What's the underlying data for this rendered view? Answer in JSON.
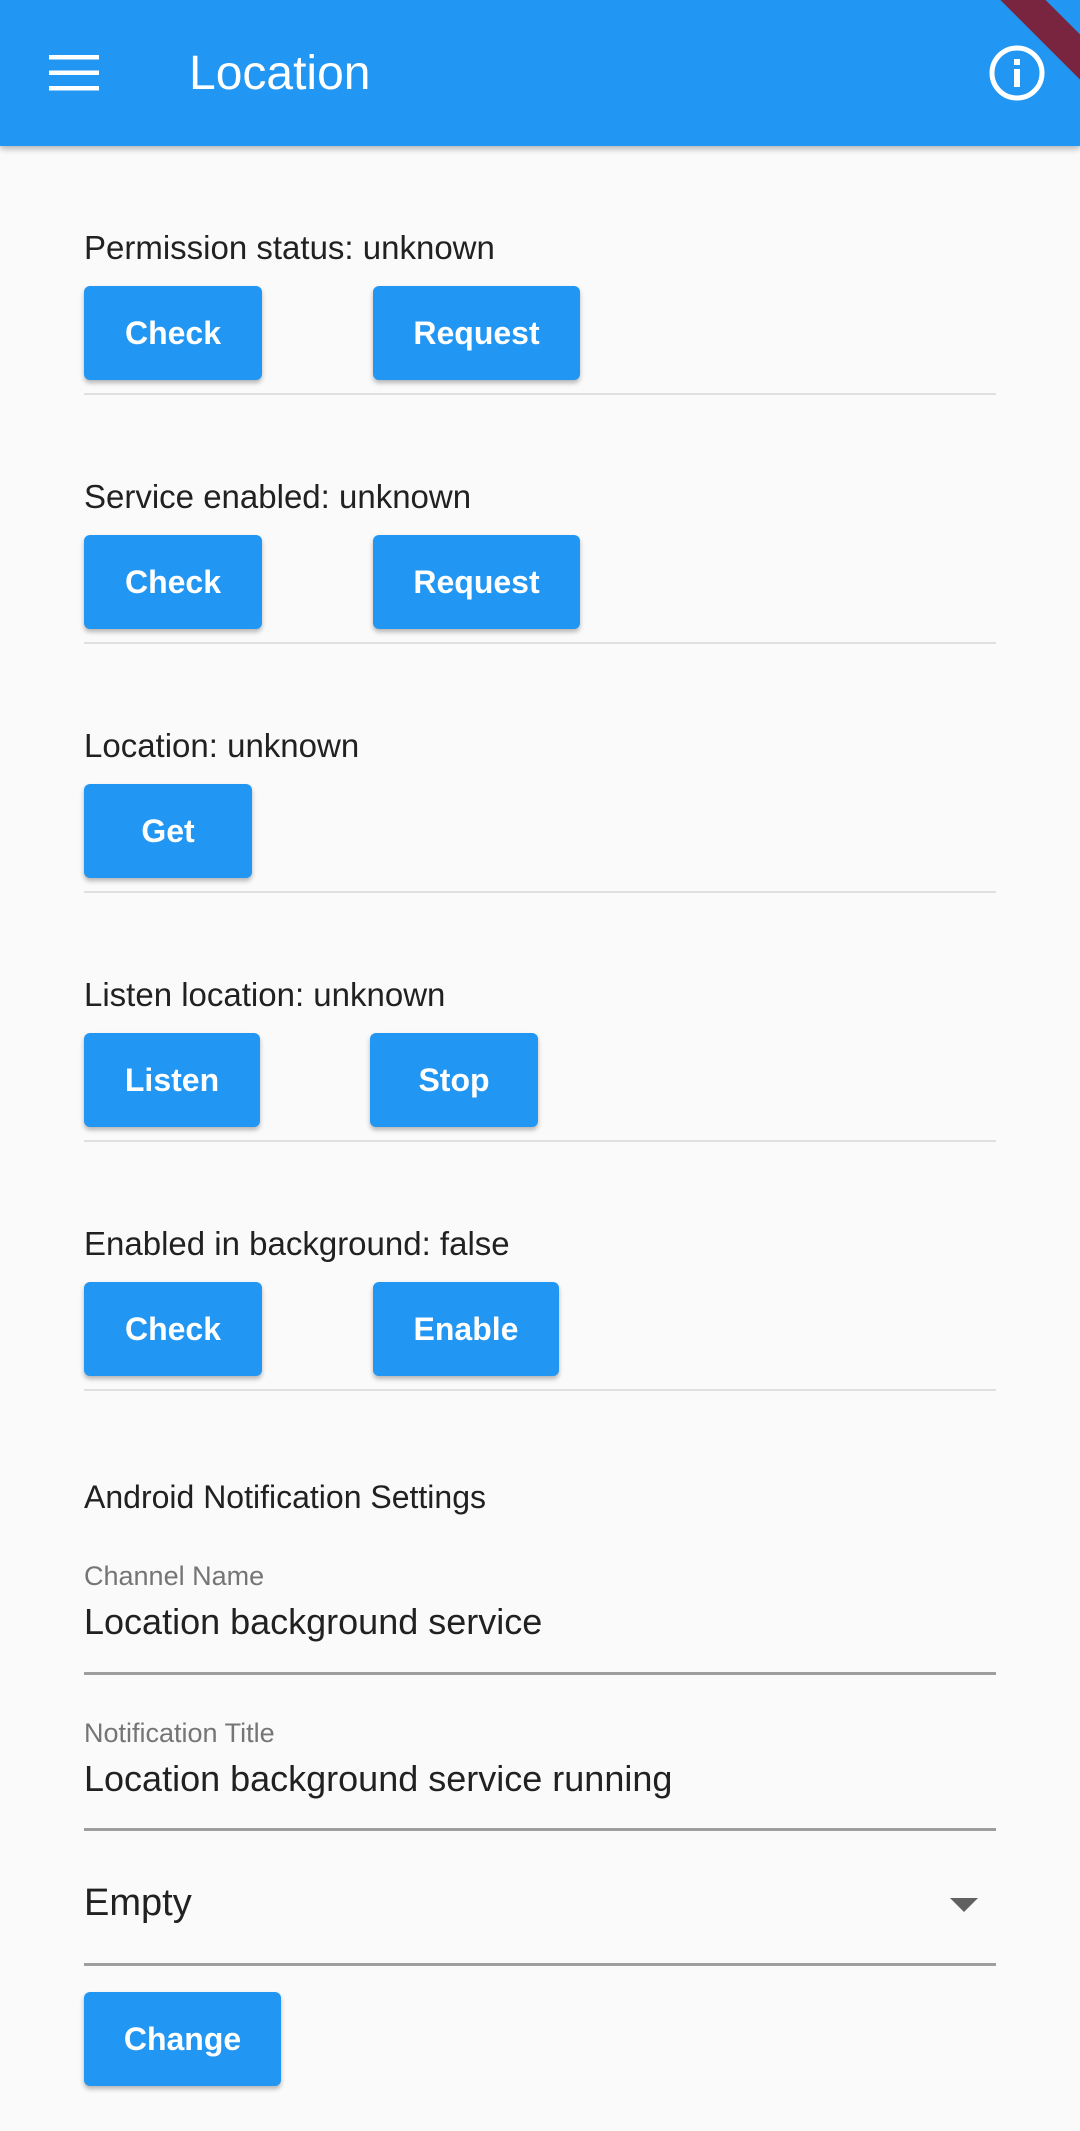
{
  "appbar": {
    "title": "Location",
    "menu_icon": "menu-icon",
    "info_icon": "info-icon"
  },
  "sections": [
    {
      "label": "Permission status: unknown",
      "buttons": [
        "Check",
        "Request"
      ]
    },
    {
      "label": "Service enabled: unknown",
      "buttons": [
        "Check",
        "Request"
      ]
    },
    {
      "label": "Location: unknown",
      "buttons": [
        "Get"
      ]
    },
    {
      "label": "Listen location: unknown",
      "buttons": [
        "Listen",
        "Stop"
      ]
    },
    {
      "label": "Enabled in background: false",
      "buttons": [
        "Check",
        "Enable"
      ]
    }
  ],
  "notification": {
    "heading": "Android Notification Settings",
    "channel_name": {
      "label": "Channel Name",
      "value": "Location background service"
    },
    "notification_title": {
      "label": "Notification Title",
      "value": "Location background service running"
    },
    "dropdown": {
      "selected": "Empty"
    },
    "change_label": "Change"
  },
  "colors": {
    "primary": "#2196f3",
    "background": "#fafafa",
    "debug_banner": "#7a2540"
  }
}
